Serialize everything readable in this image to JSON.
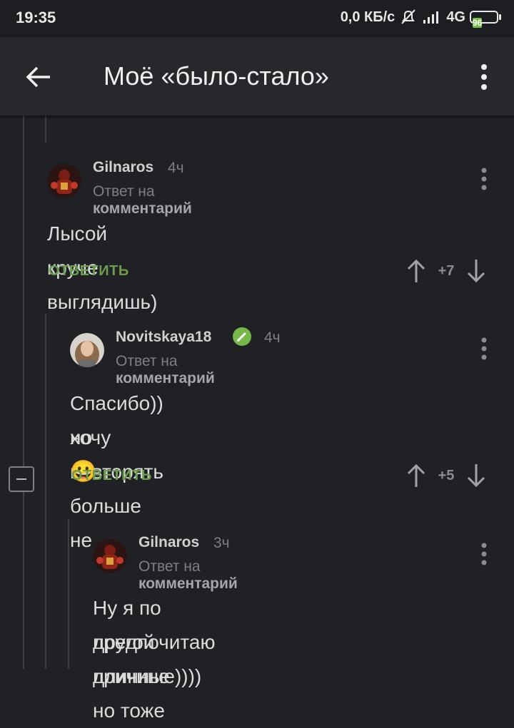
{
  "status_bar": {
    "time": "19:35",
    "net_speed": "0,0 КБ/с",
    "network": "4G",
    "battery": "96"
  },
  "app_bar": {
    "title": "Моё «было-стало»"
  },
  "comments": [
    {
      "username": "Gilnaros",
      "time": "4ч",
      "reply_prefix": "Ответ на",
      "reply_target": "комментарий",
      "text": "Лысой круче выглядишь)",
      "reply_label": "ОТВЕТИТЬ",
      "rating": "+7"
    },
    {
      "username": "Novitskaya18",
      "time": "4ч",
      "reply_prefix": "Ответ на",
      "reply_target": "комментарий",
      "text_line1": "Спасибо)) но повторять больше не",
      "text_line2": "хочу",
      "emoji": "😀",
      "reply_label": "ОТВЕТИТЬ",
      "rating": "+5"
    },
    {
      "username": "Gilnaros",
      "time": "3ч",
      "reply_prefix": "Ответ на",
      "reply_target": "комментарий",
      "text_line1": "Ну я по другой причине но тоже",
      "text_line2": "предпочитаю длинные))))"
    }
  ]
}
